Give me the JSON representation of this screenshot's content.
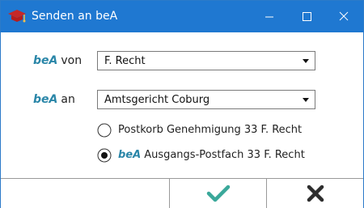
{
  "window": {
    "title": "Senden an beA",
    "icon": "bea-graduation-cap-icon",
    "accent_color": "#1f78d1",
    "controls": [
      "minimize-icon",
      "maximize-icon",
      "close-icon"
    ]
  },
  "form": {
    "von": {
      "brand": "beA",
      "label": "von",
      "value": "F. Recht"
    },
    "an": {
      "brand": "beA",
      "label": "an",
      "value": "Amtsgericht Coburg"
    },
    "radio_options": [
      {
        "brand": "",
        "label": "Postkorb Genehmigung 33 F. Recht",
        "selected": false
      },
      {
        "brand": "beA",
        "label": "Ausgangs-Postfach 33 F. Recht",
        "selected": true
      }
    ]
  },
  "buttons": {
    "ok_icon": "checkmark-icon",
    "ok_color": "#3aa89a",
    "cancel_icon": "x-icon",
    "cancel_color": "#2d2d2d"
  }
}
